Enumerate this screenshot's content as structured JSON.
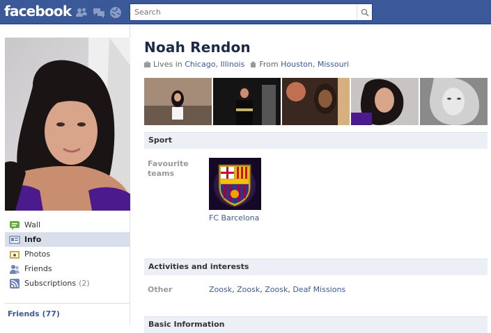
{
  "topbar": {
    "logo": "facebook",
    "jewels": [
      "friend-requests-icon",
      "messages-icon",
      "notifications-globe-icon"
    ],
    "search_placeholder": "Search",
    "search_icon": "magnifier-icon",
    "bg_color": "#3b5998"
  },
  "profile": {
    "name": "Noah Rendon",
    "lives_prefix": "Lives in",
    "lives_city": "Chicago",
    "lives_state": "Illinois",
    "from_prefix": "From",
    "from_city": "Houston",
    "from_state": "Missouri"
  },
  "nav": {
    "items": [
      {
        "label": "Wall",
        "icon": "wall-icon"
      },
      {
        "label": "Info",
        "icon": "info-icon",
        "active": true
      },
      {
        "label": "Photos",
        "icon": "photos-icon"
      },
      {
        "label": "Friends",
        "icon": "friends-icon"
      },
      {
        "label": "Subscriptions",
        "icon": "subscriptions-icon",
        "count": "(2)"
      }
    ],
    "friends_link": "Friends (77)"
  },
  "sections": {
    "sport": {
      "heading": "Sport",
      "label": "Favourite teams",
      "team": "FC Barcelona"
    },
    "activities": {
      "heading": "Activities and interests",
      "label": "Other",
      "items": [
        "Zoosk",
        "Zoosk",
        "Zoosk",
        "Deaf Missions"
      ]
    },
    "basic": {
      "heading": "Basic Information"
    }
  },
  "colors": {
    "link": "#3b5998",
    "section_bg": "#eceff5",
    "nav_active_bg": "#d8dfea"
  }
}
